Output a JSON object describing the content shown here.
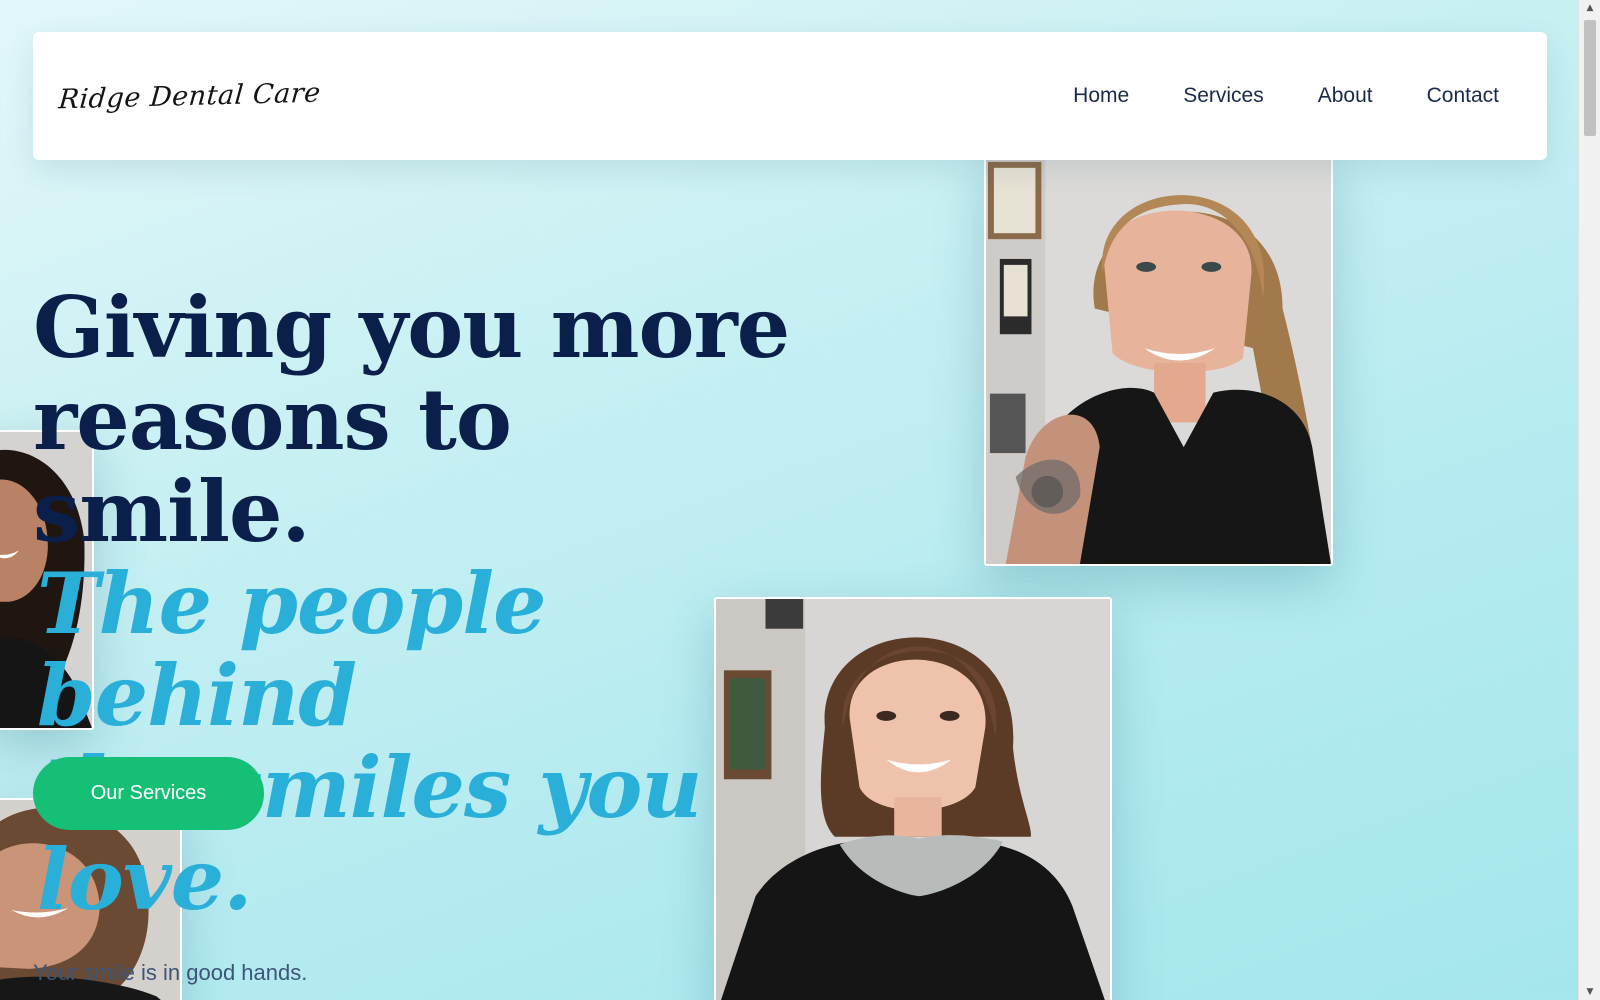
{
  "header": {
    "logo": "Ridge Dental Care",
    "nav": [
      {
        "label": "Home"
      },
      {
        "label": "Services"
      },
      {
        "label": "About"
      },
      {
        "label": "Contact"
      }
    ]
  },
  "hero": {
    "headline_line1": "Giving you more",
    "headline_line2": "reasons to smile.",
    "subhead_line1": "The people behind",
    "subhead_line2": "the smiles you love.",
    "tagline": "Your smile is in good hands.",
    "cta_label": "Our Services"
  },
  "colors": {
    "background": "#bdeef2",
    "headline": "#0b1f4b",
    "subhead": "#2aafd9",
    "cta": "#15bf75",
    "nav_text": "#1a2a4a"
  },
  "photos": [
    {
      "name": "team-photo-tattooed-woman"
    },
    {
      "name": "team-photo-woman-collar"
    },
    {
      "name": "team-photo-woman-left-partial"
    },
    {
      "name": "team-photo-woman-bottom-left-partial"
    }
  ],
  "icons": {
    "scroll_up": "scroll-up-arrow-icon",
    "scroll_down": "scroll-down-arrow-icon"
  }
}
